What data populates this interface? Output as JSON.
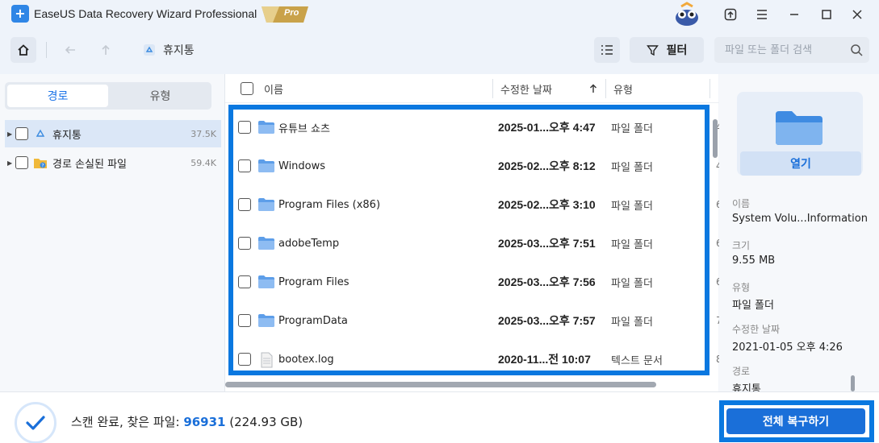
{
  "app": {
    "title": "EaseUS Data Recovery Wizard Professional",
    "badge": "Pro",
    "brand_color": "#1a6fd9"
  },
  "toolbar": {
    "breadcrumb": "휴지통",
    "filter_label": "필터",
    "search_placeholder": "파일 또는 폴더 검색"
  },
  "sidebar": {
    "tabs": [
      {
        "label": "경로",
        "active": true
      },
      {
        "label": "유형",
        "active": false
      }
    ],
    "tree": [
      {
        "label": "휴지통",
        "count": "37.5K",
        "icon": "recycle-bin-icon",
        "selected": true
      },
      {
        "label": "경로 손실된 파일",
        "count": "59.4K",
        "icon": "lost-path-folder-icon",
        "selected": false
      }
    ]
  },
  "list": {
    "columns": {
      "name": "이름",
      "date": "수정한 날짜",
      "type": "유형"
    },
    "rows": [
      {
        "name": "유튜브 쇼츠",
        "date": "2025-01...오후 4:47",
        "type": "파일 폴더",
        "edge": "4",
        "icon": "folder-icon"
      },
      {
        "name": "Windows",
        "date": "2025-02...오후 8:12",
        "type": "파일 폴더",
        "edge": "4",
        "icon": "folder-icon"
      },
      {
        "name": "Program Files (x86)",
        "date": "2025-02...오후 3:10",
        "type": "파일 폴더",
        "edge": "6",
        "icon": "folder-icon"
      },
      {
        "name": "adobeTemp",
        "date": "2025-03...오후 7:51",
        "type": "파일 폴더",
        "edge": "6",
        "icon": "folder-icon"
      },
      {
        "name": "Program Files",
        "date": "2025-03...오후 7:56",
        "type": "파일 폴더",
        "edge": "6",
        "icon": "folder-icon"
      },
      {
        "name": "ProgramData",
        "date": "2025-03...오후 7:57",
        "type": "파일 폴더",
        "edge": "7",
        "icon": "folder-icon"
      },
      {
        "name": "bootex.log",
        "date": "2020-11...전 10:07",
        "type": "텍스트 문서",
        "edge": "8",
        "icon": "text-file-icon"
      }
    ]
  },
  "details": {
    "open_label": "열기",
    "fields": [
      {
        "label": "이름",
        "value": "System Volu...Information"
      },
      {
        "label": "크기",
        "value": "9.55 MB"
      },
      {
        "label": "유형",
        "value": "파일 폴더"
      },
      {
        "label": "수정한 날짜",
        "value": "2021-01-05 오후 4:26"
      },
      {
        "label": "경로",
        "value": "휴지통"
      }
    ]
  },
  "footer": {
    "status_prefix": "스캔 완료, 찾은 파일:",
    "found_count": "96931",
    "found_size": "(224.93 GB)",
    "recover_all_label": "전체 복구하기"
  }
}
